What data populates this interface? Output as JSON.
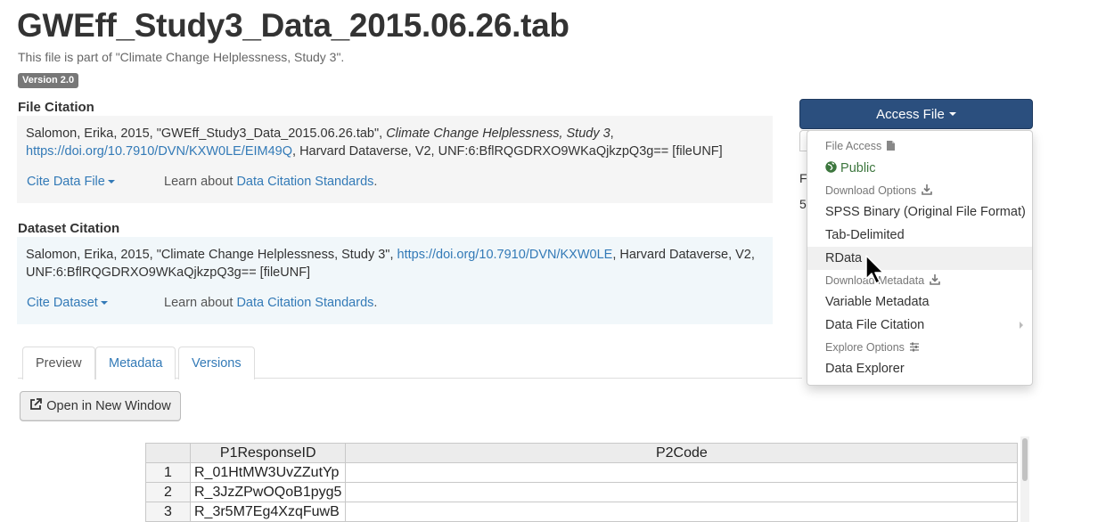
{
  "page": {
    "title": "GWEff_Study3_Data_2015.06.26.tab",
    "part_of": "This file is part of \"Climate Change Helplessness, Study 3\".",
    "version_badge": "Version 2.0"
  },
  "file_citation": {
    "label": "File Citation",
    "text_prefix": "Salomon, Erika, 2015, \"GWEff_Study3_Data_2015.06.26.tab\", ",
    "text_italic": "Climate Change Helplessness, Study 3",
    "text_comma": ",",
    "doi_link": "https://doi.org/10.7910/DVN/KXW0LE/EIM49Q",
    "text_suffix": ", Harvard Dataverse, V2, UNF:6:BflRQGDRXO9WKaQjkzpQ3g== [fileUNF]",
    "cite_button": "Cite Data File",
    "learn_text": "Learn about ",
    "learn_link": "Data Citation Standards",
    "learn_period": "."
  },
  "dataset_citation": {
    "label": "Dataset Citation",
    "text_prefix": "Salomon, Erika, 2015, \"Climate Change Helplessness, Study 3\", ",
    "doi_link": "https://doi.org/10.7910/DVN/KXW0LE",
    "text_suffix": ", Harvard Dataverse, V2,",
    "text_line2": "UNF:6:BflRQGDRXO9WKaQjkzpQ3g== [fileUNF]",
    "cite_button": "Cite Dataset",
    "learn_text": "Learn about ",
    "learn_link": "Data Citation Standards",
    "learn_period": "."
  },
  "tabs": [
    {
      "label": "Preview",
      "active": true
    },
    {
      "label": "Metadata",
      "active": false
    },
    {
      "label": "Versions",
      "active": false
    }
  ],
  "open_window_button": "Open in New Window",
  "table": {
    "columns": [
      "",
      "P1ResponseID",
      "P2Code"
    ],
    "rows": [
      [
        "1",
        "R_01HtMW3UvZZutYp",
        ""
      ],
      [
        "2",
        "R_3JzZPwOQoB1pyg5",
        ""
      ],
      [
        "3",
        "R_3r5M7Eg4XzqFuwB",
        ""
      ]
    ]
  },
  "access_file": {
    "button_label": "Access File",
    "behind_text_1": "F",
    "behind_text_2": "5",
    "menu": {
      "file_access_header": "File Access",
      "public_label": "Public",
      "download_options_header": "Download Options",
      "spss_label": "SPSS Binary (Original File Format)",
      "tab_delimited_label": "Tab-Delimited",
      "rdata_label": "RData",
      "download_metadata_header": "Download Metadata",
      "variable_metadata_label": "Variable Metadata",
      "data_file_citation_label": "Data File Citation",
      "explore_options_header": "Explore Options",
      "data_explorer_label": "Data Explorer"
    }
  },
  "colors": {
    "link": "#337ab7",
    "access_button": "#2b4f7e",
    "public_green": "#3c763d",
    "version_badge": "#777777"
  }
}
